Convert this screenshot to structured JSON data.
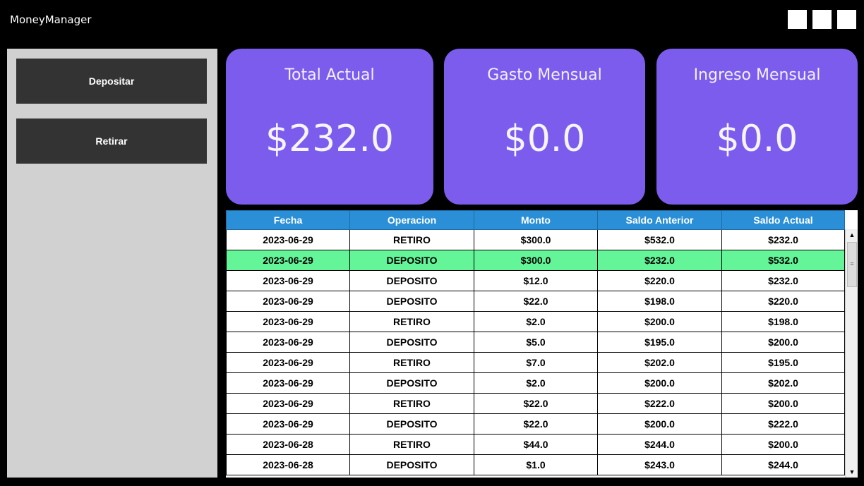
{
  "window": {
    "title": "MoneyManager"
  },
  "sidebar": {
    "deposit_label": "Depositar",
    "withdraw_label": "Retirar"
  },
  "cards": [
    {
      "title": "Total Actual",
      "value": "$232.0"
    },
    {
      "title": "Gasto Mensual",
      "value": "$0.0"
    },
    {
      "title": "Ingreso Mensual",
      "value": "$0.0"
    }
  ],
  "table": {
    "headers": [
      "Fecha",
      "Operacion",
      "Monto",
      "Saldo Anterior",
      "Saldo Actual"
    ],
    "selected_row": 1,
    "rows": [
      [
        "2023-06-29",
        "RETIRO",
        "$300.0",
        "$532.0",
        "$232.0"
      ],
      [
        "2023-06-29",
        "DEPOSITO",
        "$300.0",
        "$232.0",
        "$532.0"
      ],
      [
        "2023-06-29",
        "DEPOSITO",
        "$12.0",
        "$220.0",
        "$232.0"
      ],
      [
        "2023-06-29",
        "DEPOSITO",
        "$22.0",
        "$198.0",
        "$220.0"
      ],
      [
        "2023-06-29",
        "RETIRO",
        "$2.0",
        "$200.0",
        "$198.0"
      ],
      [
        "2023-06-29",
        "DEPOSITO",
        "$5.0",
        "$195.0",
        "$200.0"
      ],
      [
        "2023-06-29",
        "RETIRO",
        "$7.0",
        "$202.0",
        "$195.0"
      ],
      [
        "2023-06-29",
        "DEPOSITO",
        "$2.0",
        "$200.0",
        "$202.0"
      ],
      [
        "2023-06-29",
        "RETIRO",
        "$22.0",
        "$222.0",
        "$200.0"
      ],
      [
        "2023-06-29",
        "DEPOSITO",
        "$22.0",
        "$200.0",
        "$222.0"
      ],
      [
        "2023-06-28",
        "RETIRO",
        "$44.0",
        "$244.0",
        "$200.0"
      ],
      [
        "2023-06-28",
        "DEPOSITO",
        "$1.0",
        "$243.0",
        "$244.0"
      ]
    ]
  },
  "colors": {
    "card": "#7b5ced",
    "header": "#2a8fd6",
    "selected_row": "#63f598"
  },
  "icons": {
    "scroll_up": "▲",
    "scroll_down": "▼",
    "thumb_grip": "≡"
  }
}
